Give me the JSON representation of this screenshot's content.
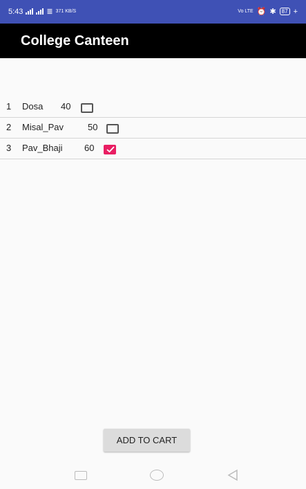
{
  "status_bar": {
    "time": "5:43",
    "net_speed": "371 KB/S",
    "right_text": "Vo LTE",
    "battery": "87"
  },
  "app_bar": {
    "title": "College Canteen"
  },
  "items": [
    {
      "id": "1",
      "name": "Dosa",
      "price": "40",
      "checked": false
    },
    {
      "id": "2",
      "name": "Misal_Pav",
      "price": "50",
      "checked": false
    },
    {
      "id": "3",
      "name": "Pav_Bhaji",
      "price": "60",
      "checked": true
    }
  ],
  "actions": {
    "add_to_cart_label": "ADD TO CART"
  },
  "colors": {
    "status_bar": "#3f51b5",
    "app_bar": "#000000",
    "checkbox_accent": "#e91e63"
  }
}
